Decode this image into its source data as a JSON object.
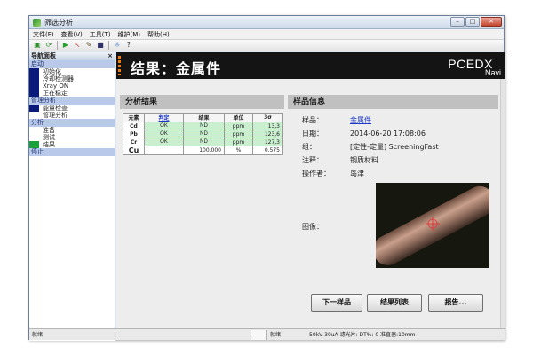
{
  "window": {
    "title": "筛选分析"
  },
  "menu": [
    "文件(F)",
    "查看(V)",
    "工具(T)",
    "维护(M)",
    "帮助(H)"
  ],
  "nav": {
    "title": "导航面板",
    "close": "×",
    "groups": [
      {
        "label": "启动",
        "items": [
          {
            "label": "初始化",
            "mark": "blue"
          },
          {
            "label": "冷却检测器",
            "mark": "blue"
          },
          {
            "label": "Xray ON",
            "mark": "blue"
          },
          {
            "label": "正在稳定",
            "mark": "blue"
          }
        ]
      },
      {
        "label": "管理分析",
        "items": [
          {
            "label": "能量检查",
            "mark": "blue"
          },
          {
            "label": "管理分析",
            "mark": "none"
          }
        ]
      },
      {
        "label": "分析",
        "items": [
          {
            "label": "准备",
            "mark": "none"
          },
          {
            "label": "测试",
            "mark": "none"
          },
          {
            "label": "结果",
            "mark": "green"
          }
        ]
      },
      {
        "label": "停止",
        "items": []
      }
    ]
  },
  "header": {
    "title": "结果：金属件",
    "brand": "PCEDX",
    "brand_sub": "Navi"
  },
  "analysis": {
    "section_title": "分析结果",
    "columns": [
      "元素",
      "判定",
      "结果",
      "单位",
      "3σ"
    ],
    "rows": [
      {
        "element": "Cd",
        "judgement": "OK",
        "result": "ND",
        "unit": "ppm",
        "sigma": "13,3"
      },
      {
        "element": "Pb",
        "judgement": "OK",
        "result": "ND",
        "unit": "ppm",
        "sigma": "123,6"
      },
      {
        "element": "Cr",
        "judgement": "OK",
        "result": "ND",
        "unit": "ppm",
        "sigma": "127,3"
      },
      {
        "element": "Cu",
        "judgement": "",
        "result": "100.000",
        "unit": "%",
        "sigma": "0.575"
      }
    ]
  },
  "sample": {
    "section_title": "样品信息",
    "fields": [
      {
        "label": "样品：",
        "value": "金属件",
        "link": true
      },
      {
        "label": "日期：",
        "value": "2014-06-20 17:08:06",
        "link": false
      },
      {
        "label": "组：",
        "value": "[定性-定量] ScreeningFast",
        "link": false
      },
      {
        "label": "注释：",
        "value": "铜质材料",
        "link": false
      },
      {
        "label": "操作者：",
        "value": "岛津",
        "link": false
      }
    ],
    "image_label": "图像："
  },
  "buttons": {
    "next": "下一样品",
    "list": "结果列表",
    "report": "报告..."
  },
  "status": {
    "ready": "就绪",
    "ready2": "就绪",
    "conditions": "50kV 30uA 滤光片: DT%: 0 准直器:10mm"
  }
}
